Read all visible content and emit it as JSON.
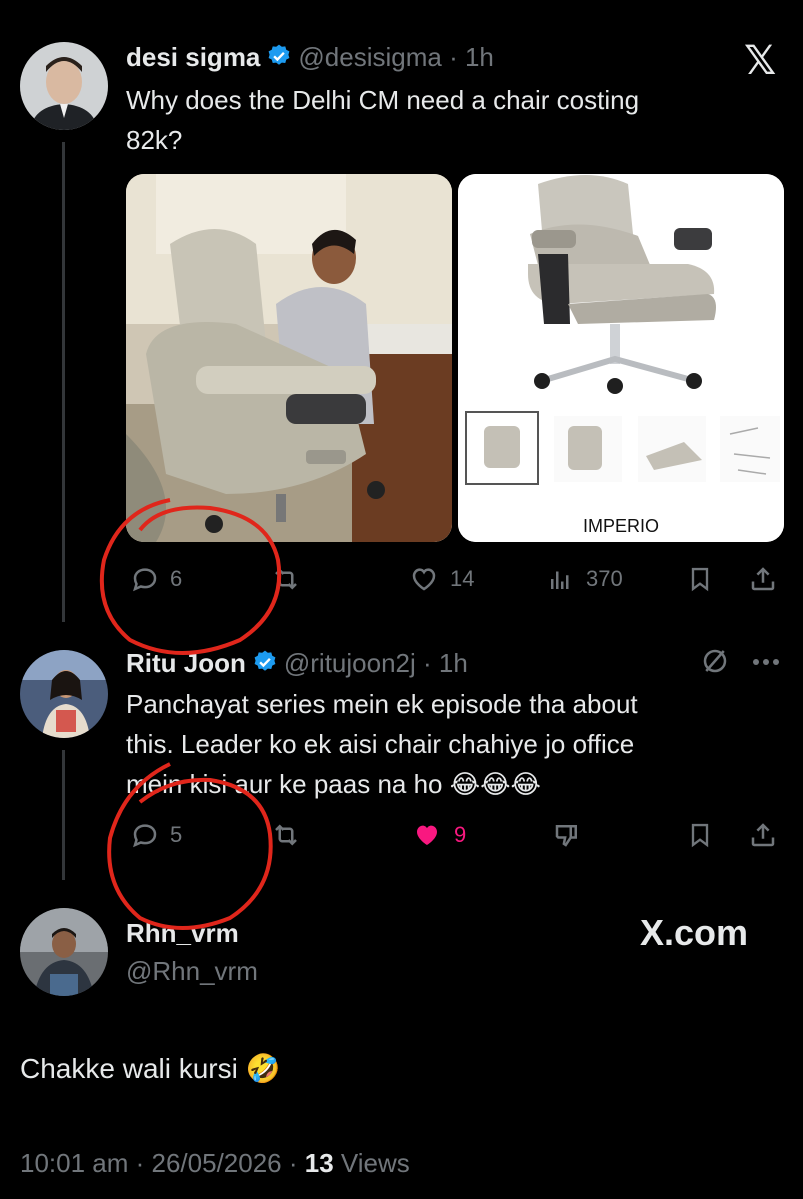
{
  "tweet": {
    "name": "desi sigma",
    "handle": "@desisigma",
    "time": "1h",
    "text_line1": "Why does the Delhi CM need a chair costing",
    "text_line2": "82k?",
    "image_right_caption": "IMPERIO",
    "actions": {
      "replies": "6",
      "likes": "14",
      "views": "370"
    }
  },
  "reply": {
    "name": "Ritu Joon",
    "handle": "@ritujoon2j",
    "time": "1h",
    "text_line1": "Panchayat series mein ek episode tha about",
    "text_line2": "this. Leader ko ek aisi chair chahiye jo office",
    "text_line3": "mein kisi aur ke paas na ho 😂😂😂",
    "actions": {
      "replies": "5",
      "likes": "9"
    }
  },
  "quote": {
    "name": "Rhn_vrm",
    "handle": "@Rhn_vrm",
    "brand": "X.com",
    "text": "Chakke wali kursi 🤣",
    "timestamp": "10:01 am · 26/05/2026 · ",
    "views_count": "13",
    "views_label": " Views"
  },
  "colors": {
    "background": "#000000",
    "text": "#e7e9ea",
    "muted": "#71767b",
    "verified": "#1d9bf0",
    "like_active": "#f91880",
    "annotation": "#e0261b"
  }
}
